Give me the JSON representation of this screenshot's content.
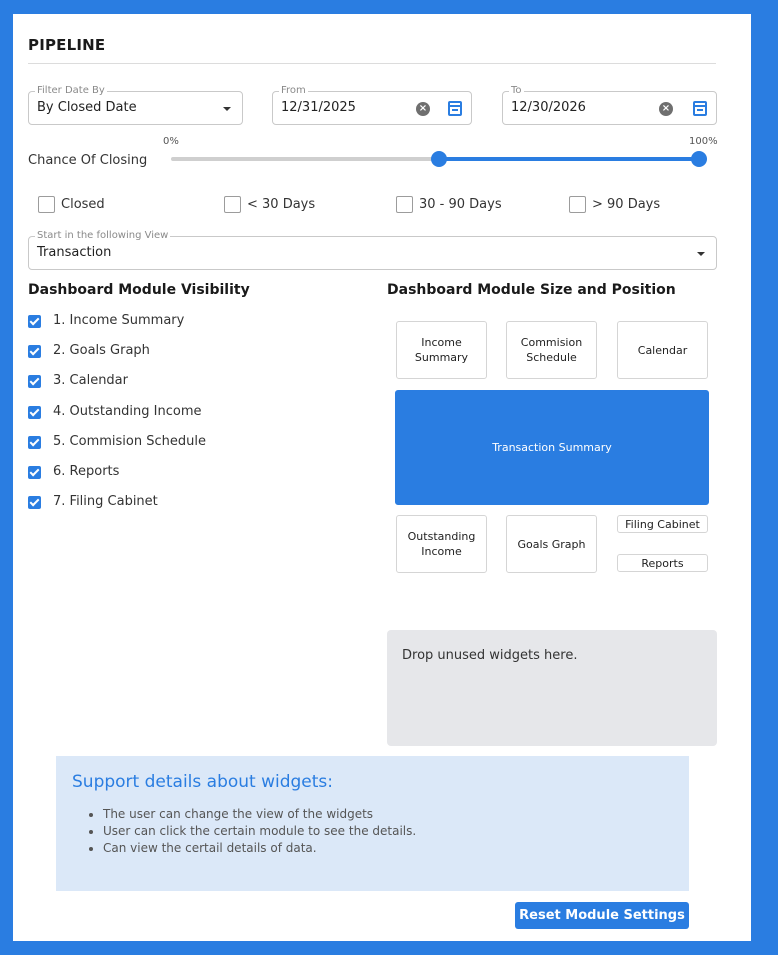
{
  "title": "PIPELINE",
  "filters": {
    "filter_date_by": {
      "legend": "Filter Date By",
      "value": "By Closed Date"
    },
    "from": {
      "legend": "From",
      "value": "12/31/2025"
    },
    "to": {
      "legend": "To",
      "value": "12/30/2026"
    }
  },
  "chance_of_closing": {
    "label": "Chance Of Closing",
    "min_label": "0%",
    "max_label": "100%",
    "range_low_fraction": 0.5,
    "range_high_fraction": 1.0
  },
  "status_filters": [
    {
      "label": "Closed",
      "checked": false
    },
    {
      "label": "< 30 Days",
      "checked": false
    },
    {
      "label": "30 - 90 Days",
      "checked": false
    },
    {
      "label": "> 90 Days",
      "checked": false
    }
  ],
  "start_view": {
    "legend": "Start in the following View",
    "value": "Transaction"
  },
  "visibility": {
    "heading": "Dashboard Module Visibility",
    "items": [
      {
        "label": "1. Income Summary",
        "checked": true
      },
      {
        "label": "2. Goals Graph",
        "checked": true
      },
      {
        "label": "3. Calendar",
        "checked": true
      },
      {
        "label": "4. Outstanding Income",
        "checked": true
      },
      {
        "label": "5. Commision Schedule",
        "checked": true
      },
      {
        "label": "6. Reports",
        "checked": true
      },
      {
        "label": "7. Filing Cabinet",
        "checked": true
      }
    ]
  },
  "layout": {
    "heading": "Dashboard Module Size and Position",
    "widgets": {
      "income_summary": "Income Summary",
      "commision_schedule": "Commision Schedule",
      "calendar": "Calendar",
      "transaction_summary": "Transaction Summary",
      "outstanding_income": "Outstanding Income",
      "goals_graph": "Goals Graph",
      "filing_cabinet": "Filing Cabinet",
      "reports": "Reports"
    },
    "dropzone_text": "Drop unused widgets here."
  },
  "support": {
    "title": "Support details about widgets:",
    "items": [
      "The user can change the view of the widgets",
      "User can click the certain module to see the details.",
      "Can view the certail details of data."
    ]
  },
  "reset_button": "Reset Module Settings",
  "colors": {
    "accent": "#2a7de1",
    "support_bg": "#dbe8f8",
    "dropzone_bg": "#e6e7ea"
  }
}
